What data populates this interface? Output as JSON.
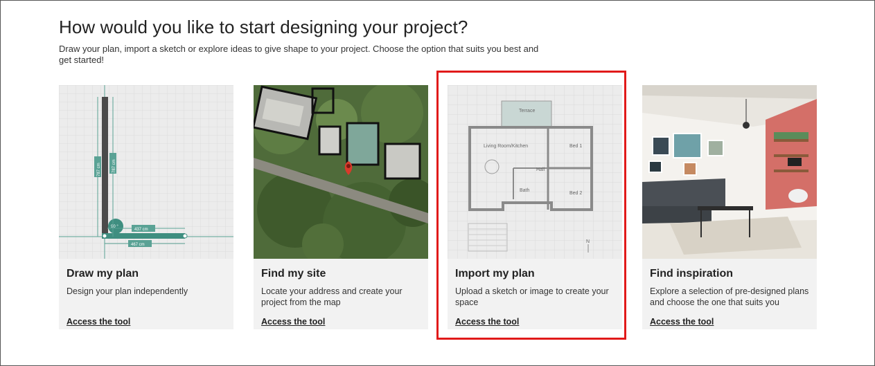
{
  "page": {
    "title": "How would you like to start designing your project?",
    "subtitle": "Draw your plan, import a sketch or explore ideas to give shape to your project. Choose the option that suits you best and get started!"
  },
  "cards": [
    {
      "title": "Draw my plan",
      "description": "Design your plan independently",
      "link": "Access the tool",
      "icon": "draw-plan-illustration"
    },
    {
      "title": "Find my site",
      "description": "Locate your address and create your project from the map",
      "link": "Access the tool",
      "icon": "satellite-map-illustration"
    },
    {
      "title": "Import my plan",
      "description": "Upload a sketch or image to create your space",
      "link": "Access the tool",
      "icon": "floor-plan-illustration",
      "highlighted": true
    },
    {
      "title": "Find inspiration",
      "description": "Explore a selection of pre-designed plans and choose the one that suits you",
      "link": "Access the tool",
      "icon": "living-room-photo"
    }
  ],
  "illustrations": {
    "draw": {
      "dim_vertical_1": "787 cm",
      "dim_vertical_2": "787 cm",
      "dim_h1": "437 cm",
      "dim_h2": "467 cm",
      "angle": "90 °"
    },
    "plan": {
      "terrace": "Terrace",
      "living": "Living Room/Kitchen",
      "bed1": "Bed 1",
      "bed2": "Bed 2",
      "hall": "Hall",
      "bath": "Bath",
      "north": "N"
    }
  },
  "colors": {
    "accent": "#e11a1a",
    "teal": "#5aa295",
    "card_bg": "#f2f2f2"
  }
}
